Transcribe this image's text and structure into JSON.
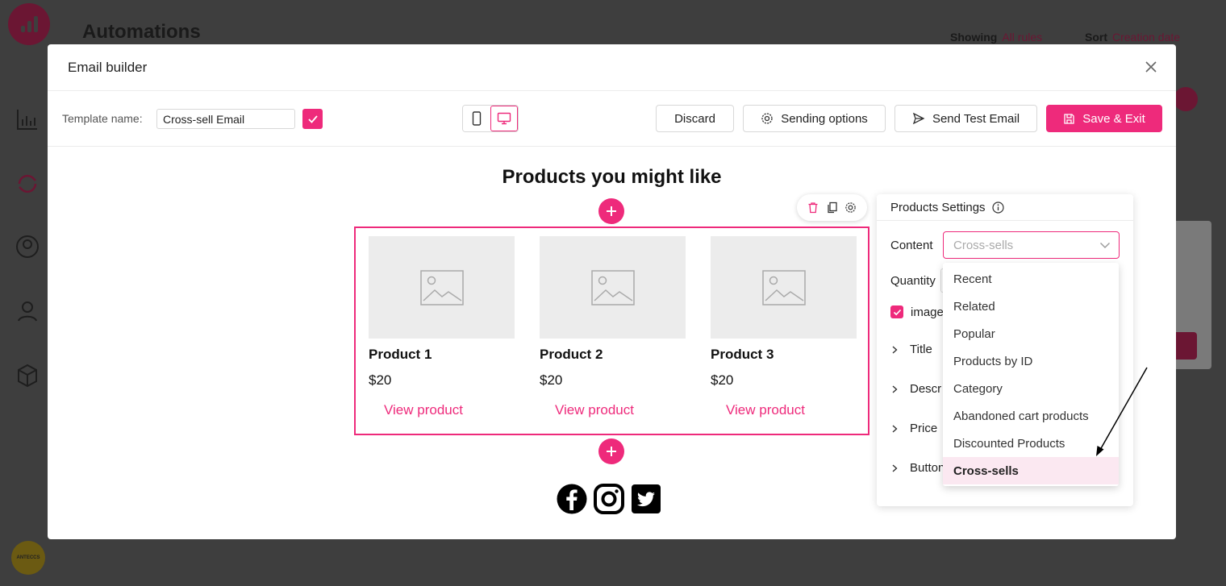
{
  "background": {
    "page_title": "Automations",
    "showing_label": "Showing",
    "showing_value": "All rules",
    "sort_label": "Sort",
    "sort_value": "Creation date",
    "avatar_text": "ANTECCS"
  },
  "modal": {
    "title": "Email builder",
    "template_name_label": "Template name:",
    "template_name_value": "Cross-sell Email",
    "buttons": {
      "discard": "Discard",
      "sending_options": "Sending options",
      "send_test": "Send Test Email",
      "save_exit": "Save & Exit"
    }
  },
  "canvas": {
    "heading": "Products you might like",
    "products": [
      {
        "name": "Product 1",
        "price": "$20",
        "link": "View product"
      },
      {
        "name": "Product 2",
        "price": "$20",
        "link": "View product"
      },
      {
        "name": "Product 3",
        "price": "$20",
        "link": "View product"
      }
    ]
  },
  "settings": {
    "title": "Products Settings",
    "content_label": "Content",
    "content_value": "Cross-sells",
    "quantity_label": "Quantity",
    "image_label": "image",
    "accordion": [
      "Title",
      "Descr",
      "Price",
      "Button"
    ]
  },
  "dropdown": {
    "options": [
      "Recent",
      "Related",
      "Popular",
      "Products by ID",
      "Category",
      "Abandoned cart products",
      "Discounted Products",
      "Cross-sells"
    ],
    "selected": "Cross-sells"
  },
  "colors": {
    "accent": "#ee2a7b",
    "dim_accent": "#6b1633"
  }
}
